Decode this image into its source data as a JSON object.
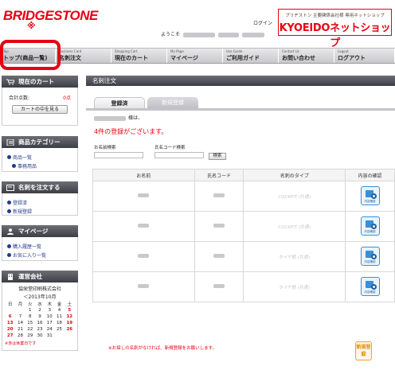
{
  "header": {
    "logo": "BRIDGESTONE",
    "logo_mark": "※",
    "login_link": "ログイン",
    "welcome_prefix": "ようこそ",
    "shop_sub": "ブリヂストン 主要関係会社様 専用ネットショップ",
    "shop_name": "KYOEIDOネットショップ"
  },
  "nav": [
    {
      "en": "Top",
      "jp": "トップ(商品一覧)"
    },
    {
      "en": "Business Card",
      "jp": "名刺注文"
    },
    {
      "en": "Shopping Cart",
      "jp": "現在のカート"
    },
    {
      "en": "My Page",
      "jp": "マイページ"
    },
    {
      "en": "Use Guide",
      "jp": "ご利用ガイド"
    },
    {
      "en": "Contact Us",
      "jp": "お問い合わせ"
    },
    {
      "en": "Logout",
      "jp": "ログアウト"
    }
  ],
  "sidebar": {
    "cart": {
      "title": "現在のカート",
      "total_label": "合計点数:",
      "total_value": "0点",
      "button": "カートの中を見る"
    },
    "categories": {
      "title": "商品カテゴリー",
      "items": [
        "商品一覧",
        "事務用品"
      ]
    },
    "order": {
      "title": "名刺を注文する",
      "items": [
        "登録済",
        "新規登録"
      ]
    },
    "mypage": {
      "title": "マイページ",
      "items": [
        "購入履歴一覧",
        "お気に入り一覧"
      ]
    },
    "company": {
      "title": "運営会社",
      "name": "協栄堂印刷株式会社",
      "month": "＜2013年10月",
      "weekdays": [
        "日",
        "月",
        "火",
        "水",
        "木",
        "金",
        "土"
      ],
      "weeks": [
        [
          "",
          "",
          "1",
          "2",
          "3",
          "4",
          "5"
        ],
        [
          "6",
          "7",
          "8",
          "9",
          "10",
          "11",
          "12"
        ],
        [
          "13",
          "14",
          "15",
          "16",
          "17",
          "18",
          "19"
        ],
        [
          "20",
          "21",
          "22",
          "23",
          "24",
          "25",
          "26"
        ],
        [
          "27",
          "28",
          "29",
          "30",
          "31",
          "",
          ""
        ]
      ],
      "note": "※赤は休業日です"
    }
  },
  "main": {
    "title": "名刺注文",
    "tabs": [
      "登録済",
      "新規登録"
    ],
    "user_suffix": "様は、",
    "count_text": "4件の登録がございます。",
    "search": {
      "name_label": "お名前検索",
      "code_label": "氏名コード検索",
      "button": "検索"
    },
    "table": {
      "headers": [
        "お名前",
        "氏名コード",
        "名刺のタイプ",
        "内容の確認"
      ],
      "rows": [
        {
          "type": "COCKPIT (共通)"
        },
        {
          "type": "COCKPIT (共通)"
        },
        {
          "type": "タイヤ館 (共通)"
        },
        {
          "type": "タイヤ館 (共通)"
        }
      ],
      "confirm_label": "内容確認"
    },
    "note": "※お探しの名刺がなければ、新規登録をお願いします。",
    "new_button": "新規登録"
  }
}
